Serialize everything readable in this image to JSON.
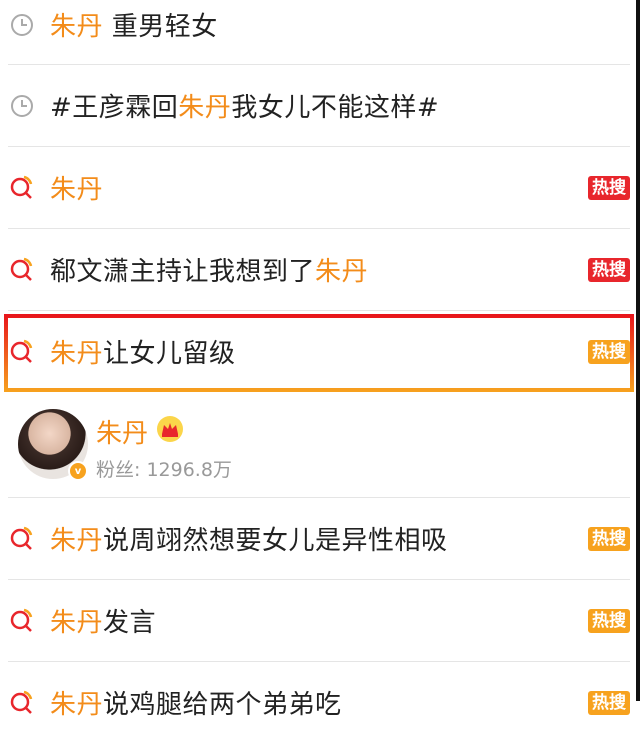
{
  "rows": [
    {
      "type": "history",
      "highlight": "朱丹",
      "rest": " 重男轻女",
      "prefix": "",
      "badge": ""
    },
    {
      "type": "history",
      "prefix": "#王彦霖回",
      "highlight": "朱丹",
      "rest": "我女儿不能这样#",
      "badge": ""
    },
    {
      "type": "search",
      "prefix": "",
      "highlight": "朱丹",
      "rest": "",
      "badge": "热搜",
      "badge_color": "#e8262c"
    },
    {
      "type": "search",
      "prefix": "郗文潇主持让我想到了",
      "highlight": "朱丹",
      "rest": "",
      "badge": "热搜",
      "badge_color": "#e8262c"
    },
    {
      "type": "search",
      "prefix": "",
      "highlight": "朱丹",
      "rest": "让女儿留级",
      "badge": "热搜",
      "badge_color": "#f7a21e"
    }
  ],
  "user": {
    "name": "朱丹",
    "fans_label": "粉丝: 1296.8万",
    "verified_icon": "v-badge-icon",
    "member_icon": "crown-icon"
  },
  "rows2": [
    {
      "type": "search",
      "prefix": "",
      "highlight": "朱丹",
      "rest": "说周翊然想要女儿是异性相吸",
      "badge": "热搜",
      "badge_color": "#f7a21e"
    },
    {
      "type": "search",
      "prefix": "",
      "highlight": "朱丹",
      "rest": "发言",
      "badge": "热搜",
      "badge_color": "#f7a21e"
    },
    {
      "type": "search",
      "prefix": "",
      "highlight": "朱丹",
      "rest": "说鸡腿给两个弟弟吃",
      "badge": "热搜",
      "badge_color": "#f7a21e"
    }
  ],
  "colors": {
    "highlight": "#f38c1a",
    "hot_red": "#e8262c",
    "hot_orange": "#f7a21e"
  }
}
